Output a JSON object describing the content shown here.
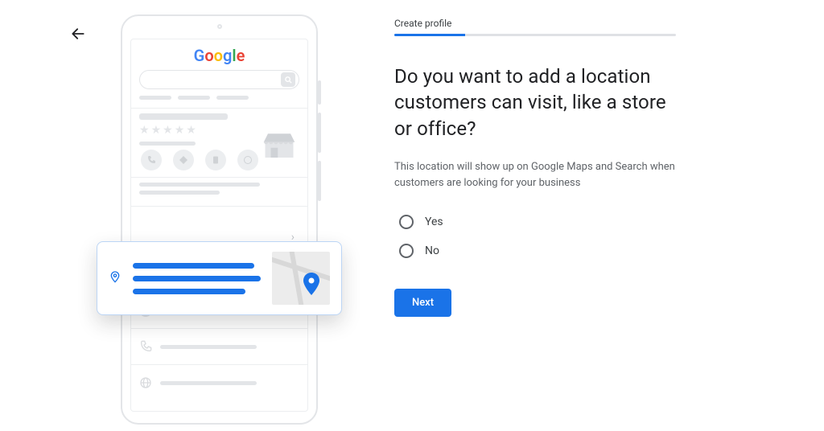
{
  "step": {
    "label": "Create profile",
    "progress_percent": 25
  },
  "question": "Do you want to add a location customers can visit, like a store or office?",
  "helper": "This location will show up on Google Maps and Search when customers are looking for your business",
  "options": {
    "yes": "Yes",
    "no": "No"
  },
  "actions": {
    "next": "Next"
  },
  "illustration": {
    "logo_letters": [
      "G",
      "o",
      "o",
      "g",
      "l",
      "e"
    ]
  }
}
